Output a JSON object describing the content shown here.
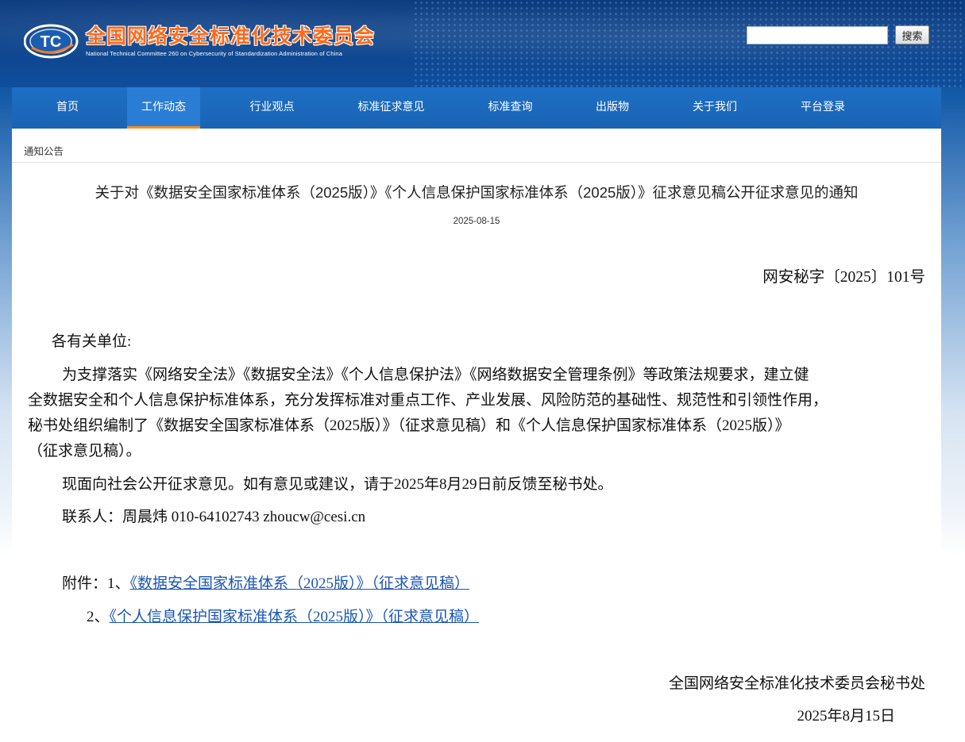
{
  "header": {
    "site_title_cn": "全国网络安全标准化技术委员会",
    "site_title_en": "National Technical Committee 260 on Cybersecurity of Standardization Administration of China",
    "logo_text": "TC",
    "search": {
      "placeholder": "",
      "button_label": "搜索"
    }
  },
  "nav": {
    "items": [
      {
        "label": "首页"
      },
      {
        "label": "工作动态"
      },
      {
        "label": "行业观点"
      },
      {
        "label": "标准征求意见"
      },
      {
        "label": "标准查询"
      },
      {
        "label": "出版物"
      },
      {
        "label": "关于我们"
      },
      {
        "label": "平台登录"
      }
    ],
    "active": "工作动态"
  },
  "breadcrumb": "通知公告",
  "article": {
    "title": "关于对《数据安全国家标准体系（2025版）》《个人信息保护国家标准体系（2025版）》征求意见稿公开征求意见的通知",
    "date": "2025-08-15",
    "doc_number": "网安秘字〔2025〕101号",
    "salutation": "各有关单位:",
    "body_lines": [
      "为支撑落实《网络安全法》《数据安全法》《个人信息保护法》《网络数据安全管理条例》等政策法规要求，建立健",
      "全数据安全和个人信息保护标准体系，充分发挥标准对重点工作、产业发展、风险防范的基础性、规范性和引领性作用，",
      "秘书处组织编制了《数据安全国家标准体系（2025版）》（征求意见稿）和《个人信息保护国家标准体系（2025版）》",
      "（征求意见稿）。"
    ],
    "notice": "现面向社会公开征求意见。如有意见或建议，请于2025年8月29日前反馈至秘书处。",
    "contact": "联系人：周晨炜  010-64102743  zhoucw@cesi.cn",
    "attachments_label": "附件：1、",
    "attachment1": "《数据安全国家标准体系（2025版）》（征求意见稿）",
    "attachment2_prefix": "2、",
    "attachment2": "《个人信息保护国家标准体系（2025版）》（征求意见稿）",
    "signature": "全国网络安全标准化技术委员会秘书处",
    "sign_date": "2025年8月15日"
  },
  "colors": {
    "header_bg": "#0b3a7e",
    "nav_bg": "#1a63b5",
    "active_underline": "#ff8a1e",
    "logo_title": "#ff6a1a",
    "link": "#1a55b5"
  }
}
